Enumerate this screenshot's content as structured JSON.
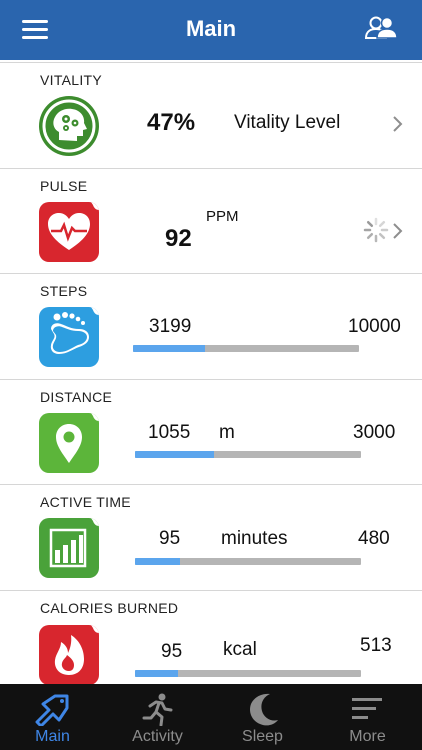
{
  "header": {
    "title": "Main"
  },
  "cards": {
    "vitality": {
      "label": "VITALITY",
      "value": "47%",
      "caption": "Vitality Level"
    },
    "pulse": {
      "label": "PULSE",
      "value": "92",
      "unit": "PPM"
    },
    "steps": {
      "label": "STEPS",
      "value": "3199",
      "goal": "10000",
      "progress": 0.32
    },
    "distance": {
      "label": "DISTANCE",
      "value": "1055",
      "unit": "m",
      "goal": "3000",
      "progress": 0.35
    },
    "active_time": {
      "label": "ACTIVE TIME",
      "value": "95",
      "unit": "minutes",
      "goal": "480",
      "progress": 0.2
    },
    "calories": {
      "label": "CALORIES BURNED",
      "value": "95",
      "unit": "kcal",
      "goal": "513",
      "progress": 0.19
    }
  },
  "tabs": [
    {
      "label": "Main",
      "icon": "main-icon",
      "active": true
    },
    {
      "label": "Activity",
      "icon": "running-icon",
      "active": false
    },
    {
      "label": "Sleep",
      "icon": "moon-icon",
      "active": false
    },
    {
      "label": "More",
      "icon": "more-icon",
      "active": false
    }
  ],
  "colors": {
    "header": "#2a65ae",
    "vitality": "#3d8c2e",
    "pulse": "#d8262e",
    "steps": "#2d9ee0",
    "distance": "#5cb53a",
    "active_time": "#4aa23a",
    "calories": "#d8262e",
    "progress_fill": "#5ba5ed",
    "progress_track": "#b5b5b5",
    "tab_active": "#3f86e6"
  }
}
